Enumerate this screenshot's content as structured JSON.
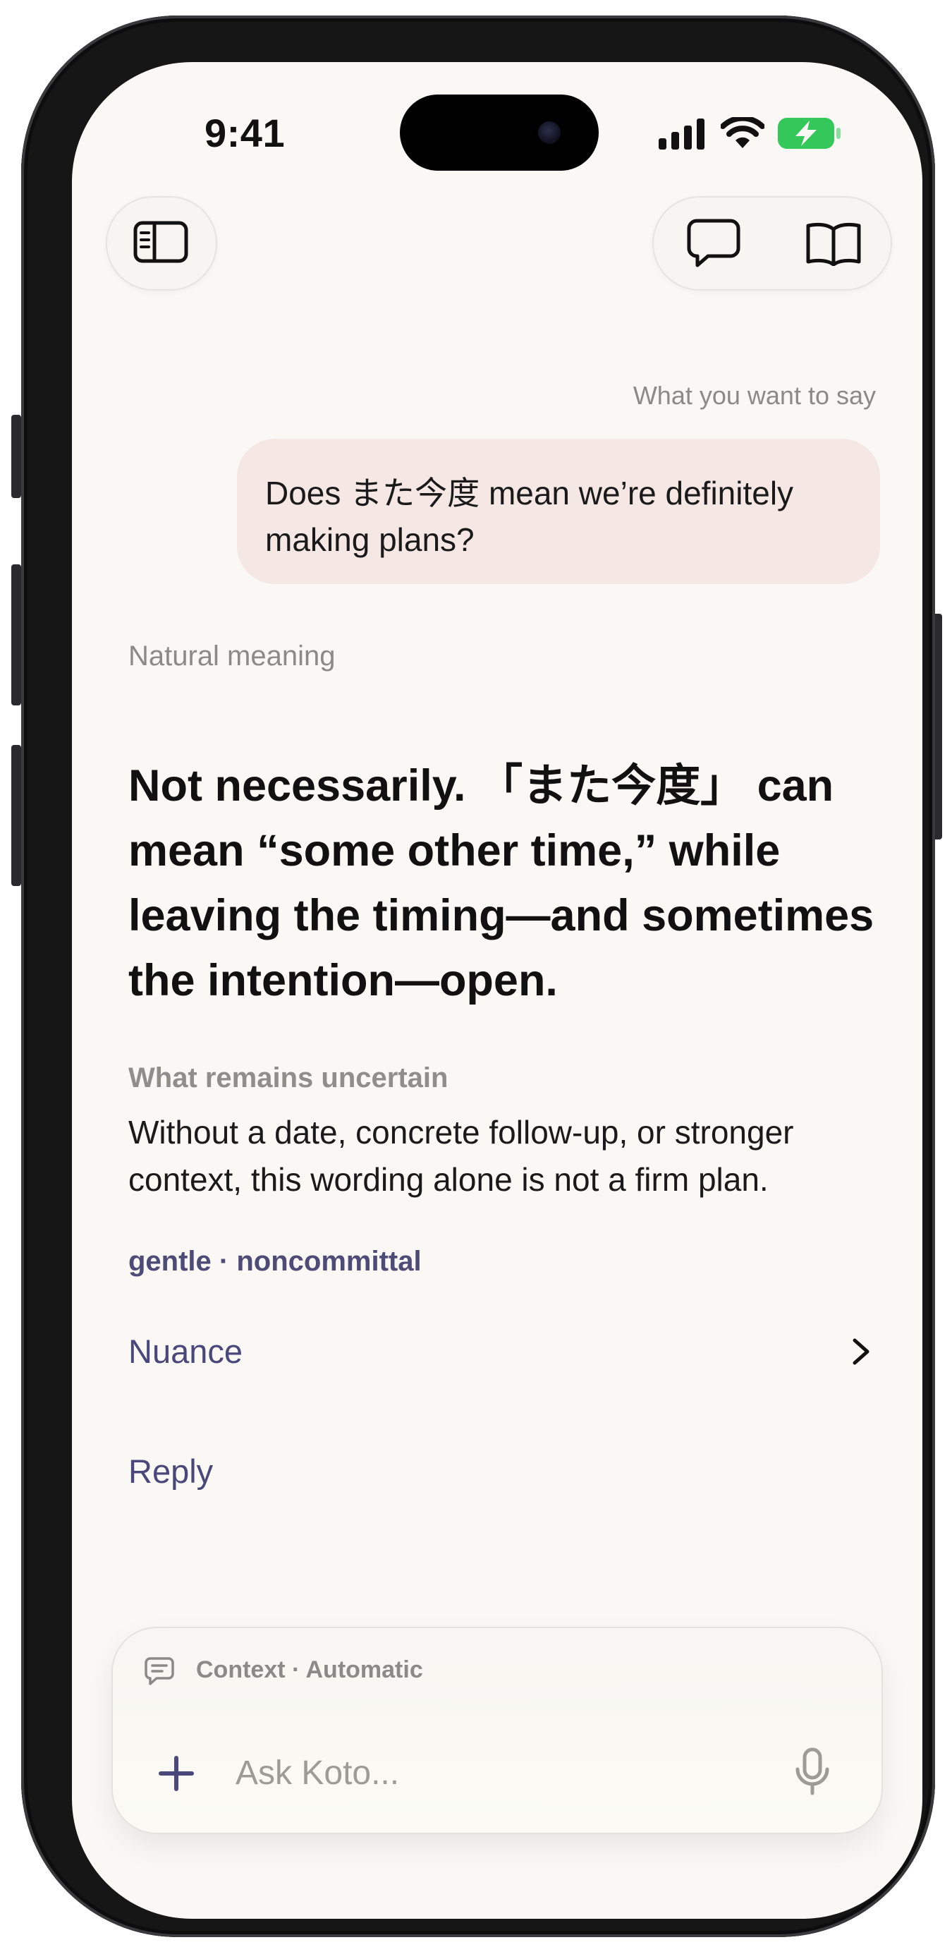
{
  "status_bar": {
    "time": "9:41",
    "icons": [
      "cellular-signal-icon",
      "wifi-icon",
      "battery-charging-icon"
    ],
    "battery_color": "#34c759"
  },
  "toolbar": {
    "sidebar_icon": "sidebar-icon",
    "chat_icon": "chat-bubble-icon",
    "book_icon": "book-icon"
  },
  "conversation": {
    "user_label": "What you want to say",
    "user_message_line1": "Does また今度 mean we’re definitely",
    "user_message_line2": "making plans?",
    "meaning_label": "Natural meaning",
    "answer_line1": "Not necessarily. 「また今度」 can",
    "answer_line2": "mean “some other time,” while",
    "answer_line3": "leaving the timing—and sometimes",
    "answer_line4": "the intention—open.",
    "uncertain_title": "What remains uncertain",
    "uncertain_line1": "Without a date, concrete follow-up, or stronger",
    "uncertain_line2": "context, this wording alone is not a firm plan.",
    "tone_tags": "gentle · noncommittal",
    "nuance_label": "Nuance",
    "reply_label": "Reply"
  },
  "composer": {
    "context_label": "Context · Automatic",
    "placeholder": "Ask Koto...",
    "value": ""
  },
  "colors": {
    "accent": "#4a477a",
    "user_bubble": "#f5e8e4",
    "background": "#f9f8f5"
  }
}
